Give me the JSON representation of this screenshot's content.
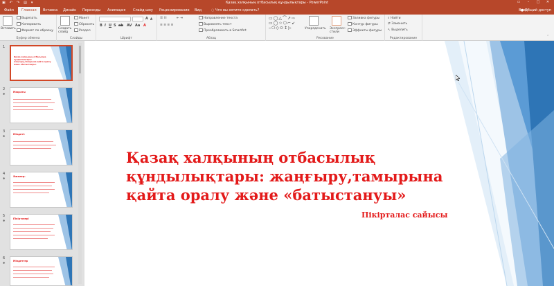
{
  "app": {
    "title": "Қазақ халқының отбасылық құндылықтары - PowerPoint",
    "signin": "Вход",
    "share": "Общий доступ"
  },
  "tabs": [
    {
      "label": "Файл"
    },
    {
      "label": "Главная"
    },
    {
      "label": "Вставка"
    },
    {
      "label": "Дизайн"
    },
    {
      "label": "Переходы"
    },
    {
      "label": "Анимация"
    },
    {
      "label": "Слайд-шоу"
    },
    {
      "label": "Рецензирование"
    },
    {
      "label": "Вид"
    }
  ],
  "tellme": "Что вы хотите сделать?",
  "ribbon": {
    "clipboard": {
      "paste": "Вставить",
      "cut": "Вырезать",
      "copy": "Копировать",
      "format_painter": "Формат по образцу",
      "label": "Буфер обмена"
    },
    "slides": {
      "new_slide": "Создать слайд",
      "layout": "Макет",
      "reset": "Сбросить",
      "section": "Раздел",
      "label": "Слайды"
    },
    "font": {
      "label": "Шрифт"
    },
    "paragraph": {
      "text_direction": "Направление текста",
      "align_text": "Выровнять текст",
      "smartart": "Преобразовать в SmartArt",
      "label": "Абзац"
    },
    "drawing": {
      "arrange": "Упорядочить",
      "quick_styles": "Экспресс-стили",
      "shape_fill": "Заливка фигуры",
      "shape_outline": "Контур фигуры",
      "shape_effects": "Эффекты фигуры",
      "label": "Рисование"
    },
    "editing": {
      "find": "Найти",
      "replace": "Заменить",
      "select": "Выделить",
      "label": "Редактирование"
    }
  },
  "thumbnails": [
    {
      "num": "1",
      "title": "Қазақ халқының отбасылық құндылықтары: жаңғыру,тамырына қайта оралу және «батыстануы»"
    },
    {
      "num": "2",
      "title": "Мақсаты"
    },
    {
      "num": "3",
      "title": "Міндеті:"
    },
    {
      "num": "4",
      "title": "Әжелер:"
    },
    {
      "num": "5",
      "title": "Пікір-өнері"
    },
    {
      "num": "6",
      "title": "Міндеттер"
    }
  ],
  "slide": {
    "title": "Қазақ халқының отбасылық құндылықтары: жаңғыру,тамырына қайта оралу және «батыстануы»",
    "subtitle": "Пікірталас сайысы"
  },
  "colors": {
    "accent": "#b7472a",
    "title_red": "#e31a1a",
    "deco_dark": "#2e75b6",
    "deco_light": "#9dc3e6"
  }
}
